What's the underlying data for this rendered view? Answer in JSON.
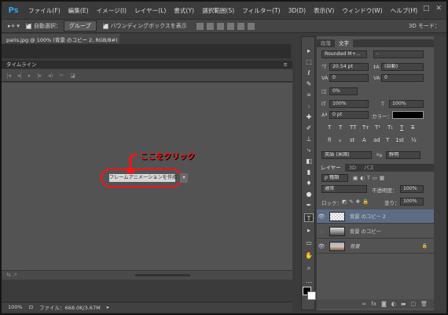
{
  "app": {
    "logo": "Ps"
  },
  "menu": [
    "ファイル(F)",
    "編集(E)",
    "イメージ(I)",
    "レイヤー(L)",
    "書式(Y)",
    "選択範囲(S)",
    "フィルター(T)",
    "3D(D)",
    "表示(V)",
    "ウィンドウ(W)",
    "ヘルプ(H)"
  ],
  "window_controls": {
    "minimize": "–",
    "maximize": "□",
    "close": "✕"
  },
  "options": {
    "auto_select_label": "自動選択：",
    "auto_select_value": "グループ",
    "bbox_label": "バウンディングボックスを表示",
    "mode3d_label": "3D モード："
  },
  "document": {
    "tab_title": "paris.jpg @ 100% (背景 のコピー 2, RGB/8#) *"
  },
  "timeline": {
    "title": "タイムライン",
    "annotation": "ここをクリック",
    "create_button": "フレームアニメーションを作成"
  },
  "status": {
    "zoom": "100%",
    "file_info": "ファイル：668.0K/3.67M"
  },
  "char_panel": {
    "tabs": [
      "段落",
      "文字"
    ],
    "font_family": "Rounded M+...",
    "font_style": "-",
    "font_size": "20.54 pt",
    "leading": "(自動)",
    "kerning": "0",
    "tracking": "0",
    "scale": "0%",
    "vscale": "100%",
    "hscale": "100%",
    "baseline": "0 pt",
    "color_label": "カラー：",
    "color_value": "#000000",
    "typo_buttons": [
      "T",
      "T",
      "TT",
      "Tт",
      "T¹",
      "T₁",
      "T",
      "T"
    ],
    "extra_buttons": [
      "fi",
      "ℴ",
      "st",
      "A",
      "ad",
      "T",
      "1st",
      "½"
    ],
    "language": "英語 (米国)",
    "aa": "鮮明"
  },
  "layers_panel": {
    "tabs": [
      "レイヤー",
      "3D",
      "パス"
    ],
    "kind": "ρ 種類",
    "blend_mode": "通常",
    "opacity_label": "不透明度：",
    "opacity": "100%",
    "lock_label": "ロック：",
    "fill_label": "塗り：",
    "fill": "100%",
    "layers": [
      {
        "name": "背景 のコピー 2",
        "visible": true,
        "selected": true
      },
      {
        "name": "背景 のコピー",
        "visible": false,
        "selected": false
      },
      {
        "name": "背景",
        "visible": true,
        "selected": false
      }
    ],
    "footer_icons": [
      "link-icon",
      "fx-icon",
      "mask-icon",
      "adjustment-icon",
      "folder-icon",
      "new-layer-icon",
      "trash-icon"
    ]
  }
}
